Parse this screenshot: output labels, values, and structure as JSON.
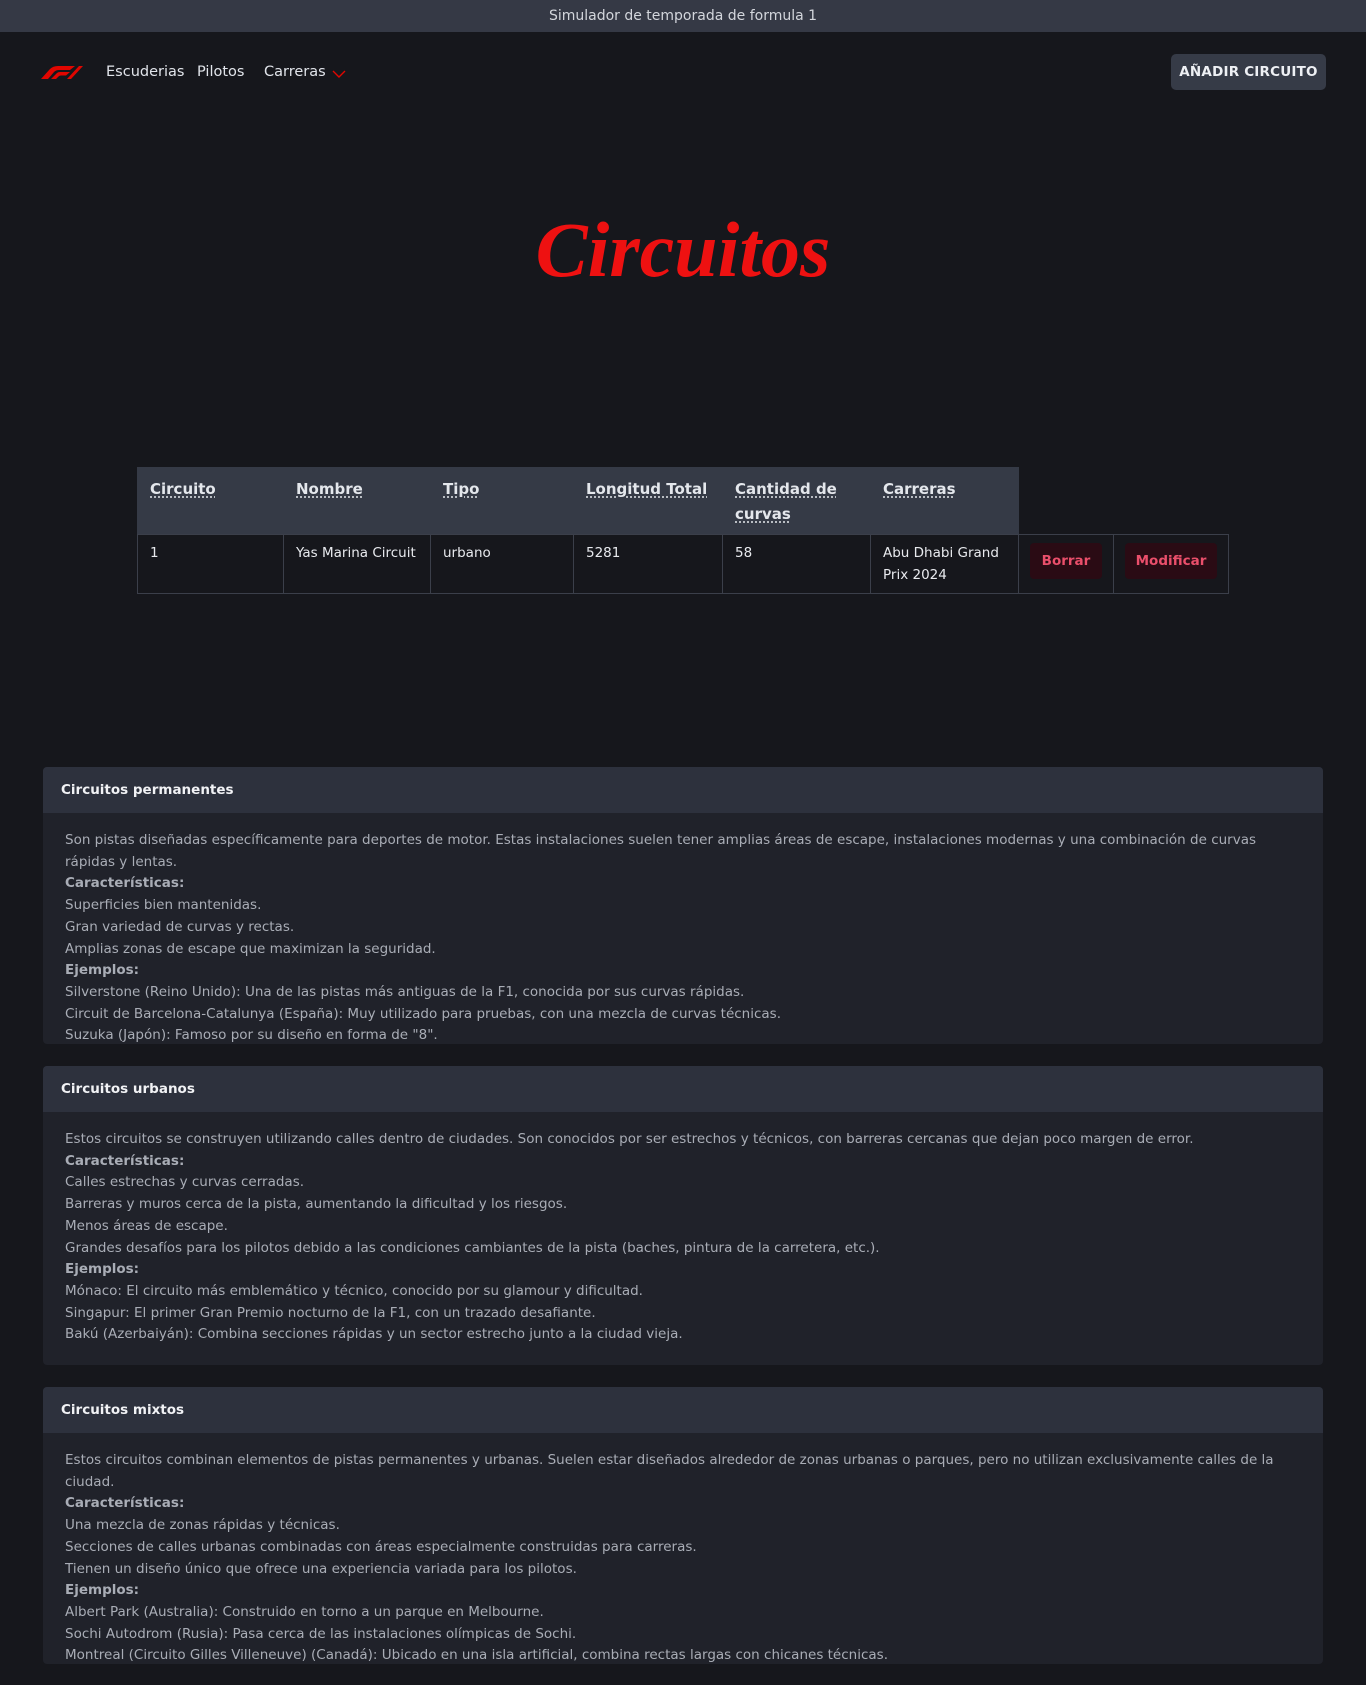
{
  "window": {
    "title": "Simulador de temporada de formula 1"
  },
  "nav": {
    "logo": "f1-logo",
    "escuderias": "Escuderias",
    "pilotos": "Pilotos",
    "carreras": "Carreras",
    "add_button": "AÑADIR CIRCUITO"
  },
  "page": {
    "title": "Circuitos"
  },
  "table": {
    "headers": [
      "Circuito",
      "Nombre",
      "Tipo",
      "Longitud Total",
      "Cantidad de curvas",
      "Carreras"
    ],
    "rows": [
      {
        "circuito": "1",
        "nombre": "Yas Marina Circuit",
        "tipo": "urbano",
        "longitud": "5281",
        "curvas": "58",
        "carreras": "Abu Dhabi Grand Prix 2024",
        "delete_label": "Borrar",
        "edit_label": "Modificar"
      }
    ]
  },
  "sections": [
    {
      "title": "Circuitos permanentes",
      "intro": "Son pistas diseñadas específicamente para deportes de motor. Estas instalaciones suelen tener amplias áreas de escape, instalaciones modernas y una combinación de curvas rápidas y lentas.",
      "features_label": "Características:",
      "features": [
        "Superficies bien mantenidas.",
        "Gran variedad de curvas y rectas.",
        "Amplias zonas de escape que maximizan la seguridad."
      ],
      "examples_label": "Ejemplos:",
      "examples": [
        "Silverstone (Reino Unido): Una de las pistas más antiguas de la F1, conocida por sus curvas rápidas.",
        "Circuit de Barcelona-Catalunya (España): Muy utilizado para pruebas, con una mezcla de curvas técnicas.",
        "Suzuka (Japón): Famoso por su diseño en forma de \"8\"."
      ]
    },
    {
      "title": "Circuitos urbanos",
      "intro": "Estos circuitos se construyen utilizando calles dentro de ciudades. Son conocidos por ser estrechos y técnicos, con barreras cercanas que dejan poco margen de error.",
      "features_label": "Características:",
      "features": [
        "Calles estrechas y curvas cerradas.",
        "Barreras y muros cerca de la pista, aumentando la dificultad y los riesgos.",
        "Menos áreas de escape.",
        "Grandes desafíos para los pilotos debido a las condiciones cambiantes de la pista (baches, pintura de la carretera, etc.)."
      ],
      "examples_label": "Ejemplos:",
      "examples": [
        "Mónaco: El circuito más emblemático y técnico, conocido por su glamour y dificultad.",
        "Singapur: El primer Gran Premio nocturno de la F1, con un trazado desafiante.",
        "Bakú (Azerbaiyán): Combina secciones rápidas y un sector estrecho junto a la ciudad vieja."
      ]
    },
    {
      "title": "Circuitos mixtos",
      "intro": "Estos circuitos combinan elementos de pistas permanentes y urbanas. Suelen estar diseñados alrededor de zonas urbanas o parques, pero no utilizan exclusivamente calles de la ciudad.",
      "features_label": "Características:",
      "features": [
        "Una mezcla de zonas rápidas y técnicas.",
        "Secciones de calles urbanas combinadas con áreas especialmente construidas para carreras.",
        "Tienen un diseño único que ofrece una experiencia variada para los pilotos."
      ],
      "examples_label": "Ejemplos:",
      "examples": [
        "Albert Park (Australia): Construido en torno a un parque en Melbourne.",
        "Sochi Autodrom (Rusia): Pasa cerca de las instalaciones olímpicas de Sochi.",
        "Montreal (Circuito Gilles Villeneuve) (Canadá): Ubicado en una isla artificial, combina rectas largas con chicanes técnicas."
      ]
    }
  ],
  "colors": {
    "accent": "#ee1111",
    "background": "#16171c",
    "danger_text": "#ea4f6b"
  }
}
